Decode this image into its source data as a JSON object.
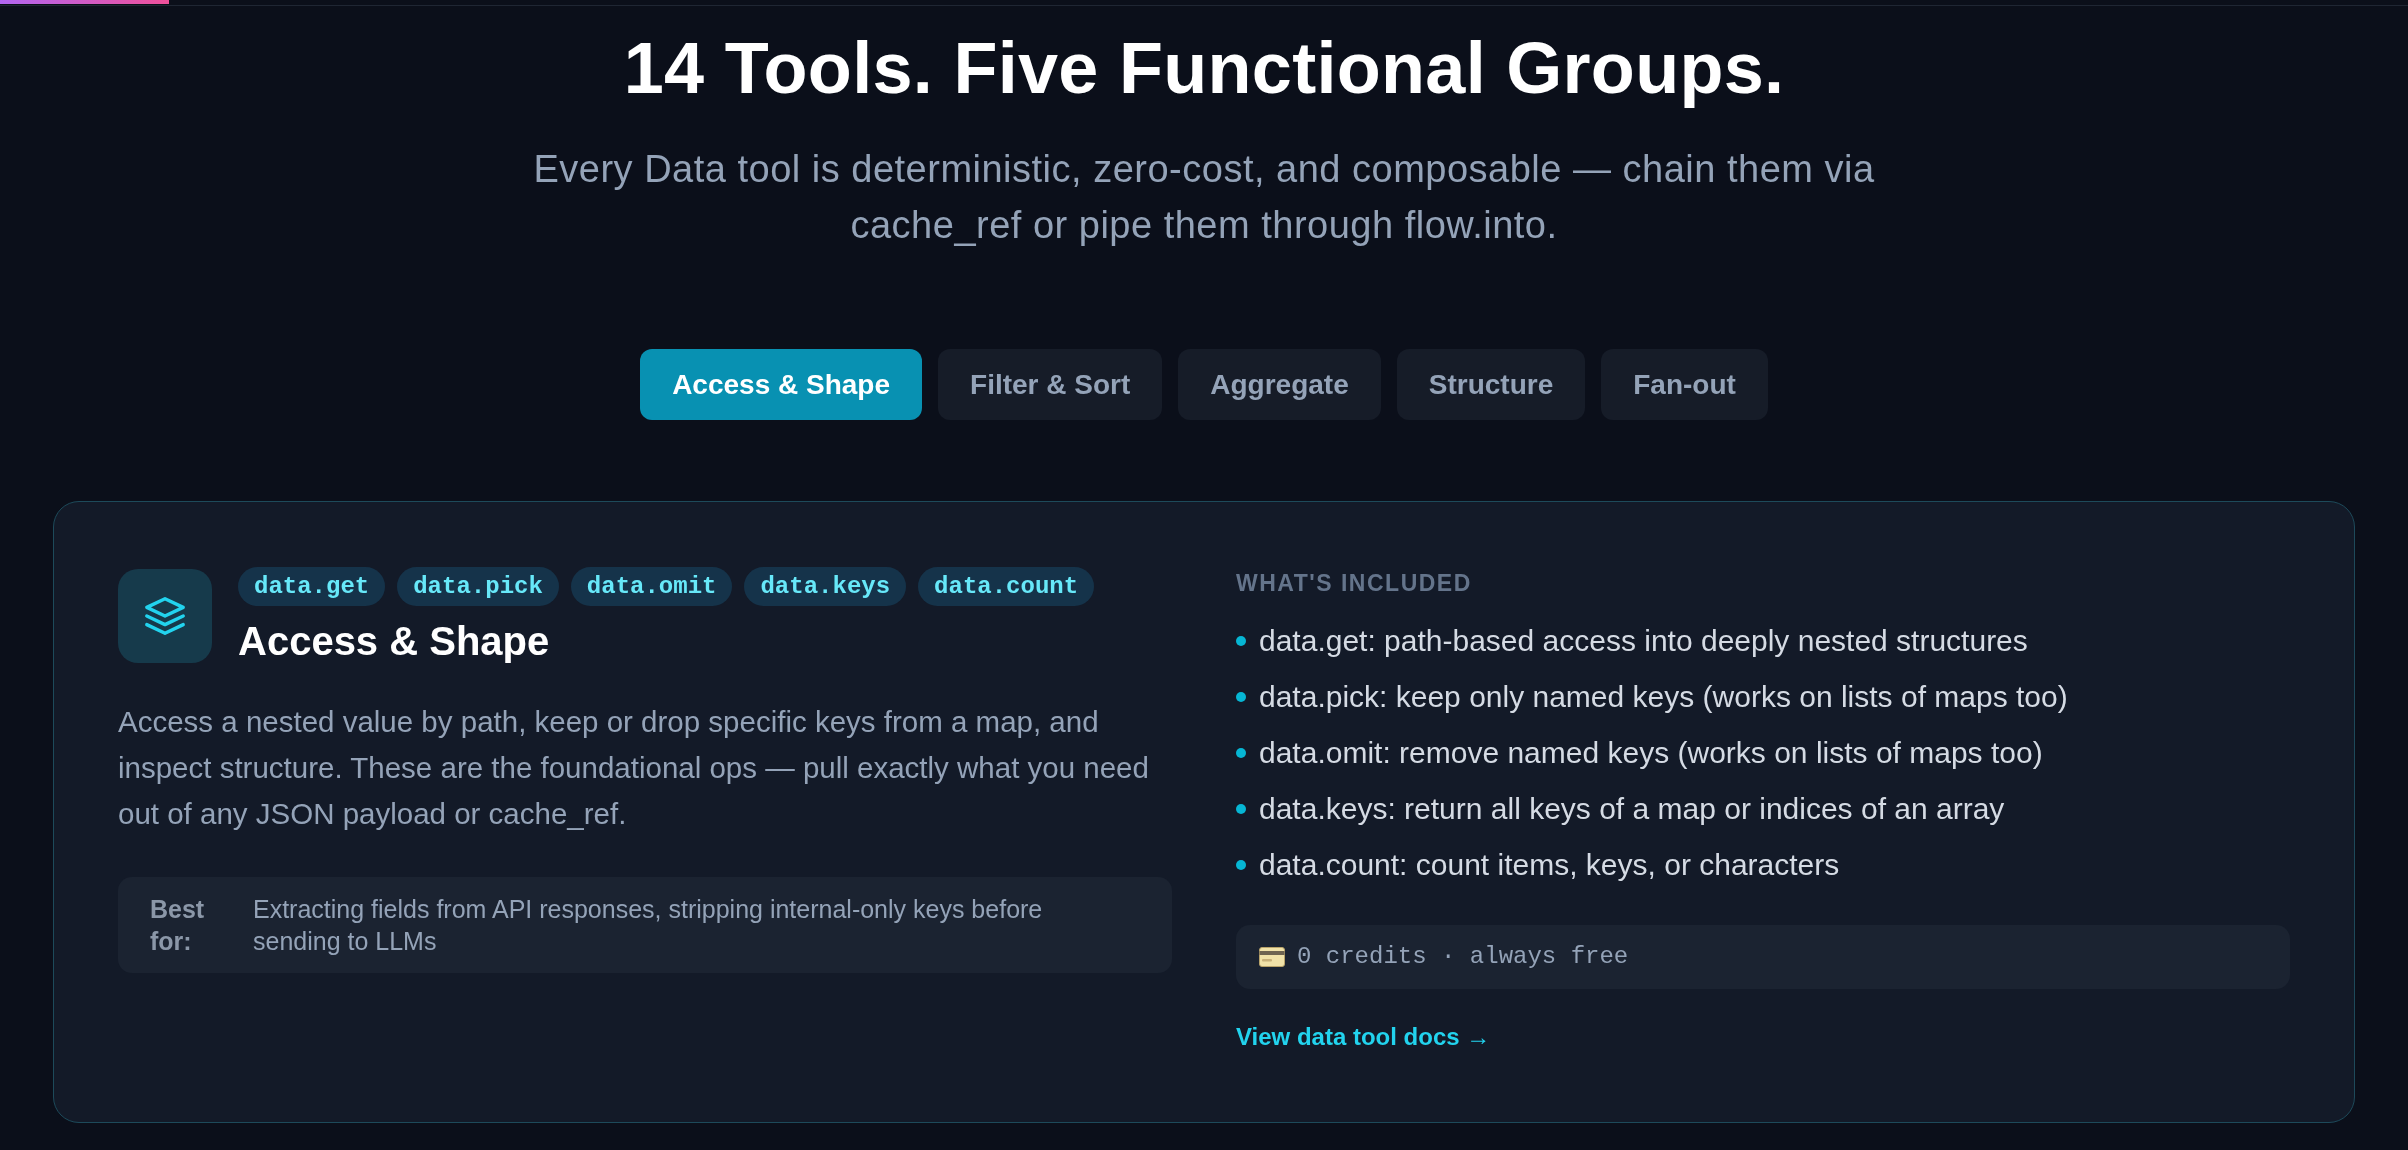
{
  "scroll_progress": {
    "level": 0.07
  },
  "header": {
    "title": "14 Tools. Five Functional Groups.",
    "subtitle": "Every Data tool is deterministic, zero-cost, and composable — chain them via cache_ref or pipe them through flow.into."
  },
  "tabs": [
    {
      "label": "Access & Shape",
      "selected": true
    },
    {
      "label": "Filter & Sort",
      "selected": false
    },
    {
      "label": "Aggregate",
      "selected": false
    },
    {
      "label": "Structure",
      "selected": false
    },
    {
      "label": "Fan-out",
      "selected": false
    }
  ],
  "panel": {
    "tools": [
      "data.get",
      "data.pick",
      "data.omit",
      "data.keys",
      "data.count"
    ],
    "title": "Access & Shape",
    "description": "Access a nested value by path, keep or drop specific keys from a map, and inspect structure. These are the foundational ops — pull exactly what you need out of any JSON payload or cache_ref.",
    "best_for": {
      "label": "Best for:",
      "text": "Extracting fields from API responses, stripping internal-only keys before sending to LLMs"
    },
    "included": {
      "heading": "WHAT'S INCLUDED",
      "items": [
        "data.get: path-based access into deeply nested structures",
        "data.pick: keep only named keys (works on lists of maps too)",
        "data.omit: remove named keys (works on lists of maps too)",
        "data.keys: return all keys of a map or indices of an array",
        "data.count: count items, keys, or characters"
      ]
    },
    "cost": "0 credits · always free",
    "link": "View data tool docs →"
  }
}
